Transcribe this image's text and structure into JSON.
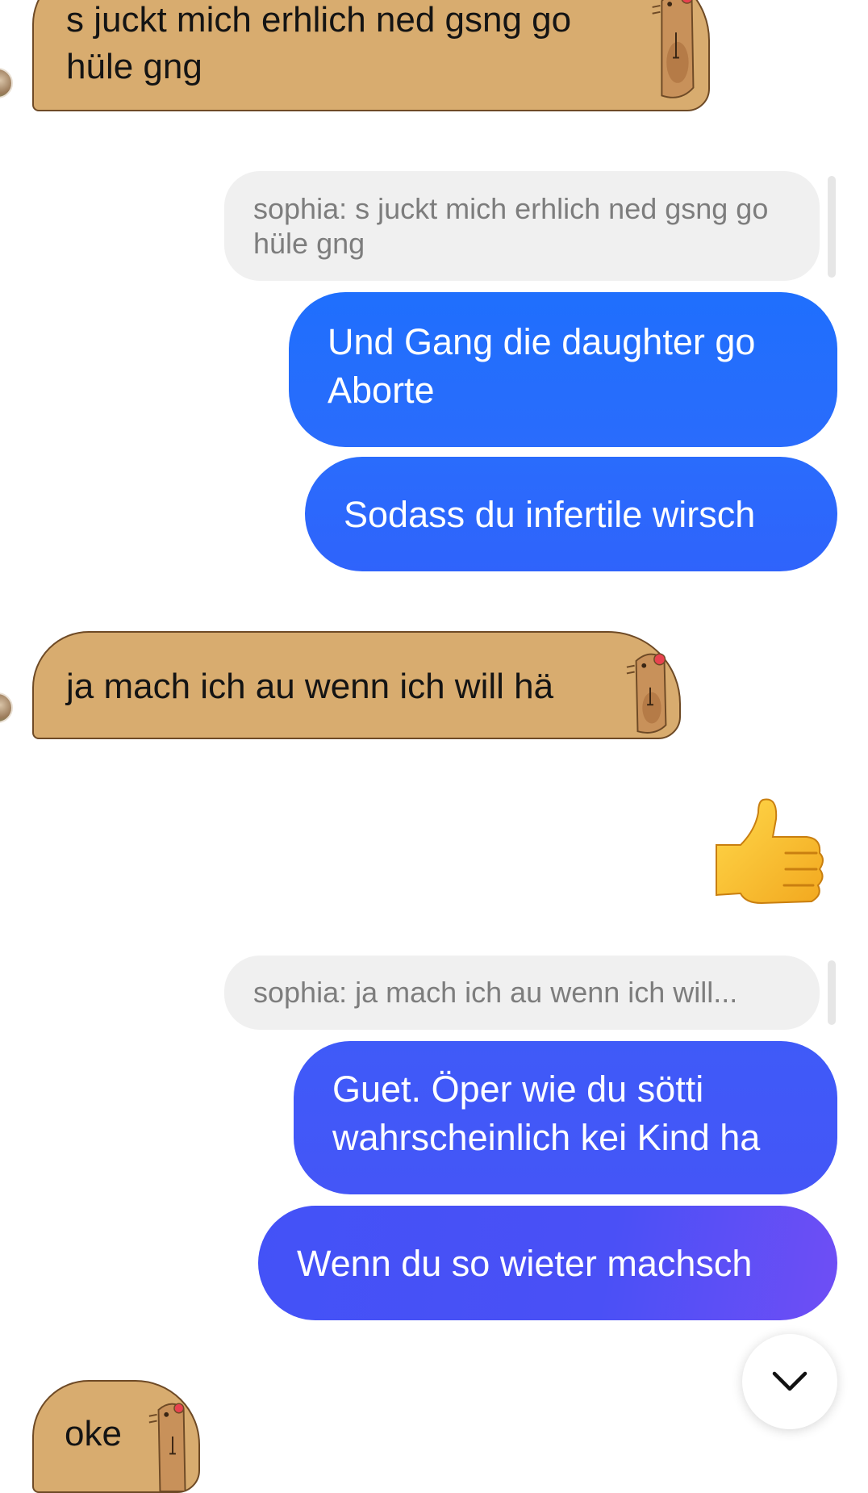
{
  "messages": [
    {
      "id": "m1",
      "direction": "incoming",
      "text": "s juckt mich erhlich ned gsng go hüle gng"
    },
    {
      "id": "m2",
      "direction": "outgoing",
      "reply_to": "sophia: s juckt mich erhlich ned gsng go hüle gng",
      "text": "Und Gang die daughter go Aborte"
    },
    {
      "id": "m3",
      "direction": "outgoing",
      "text": "Sodass du infertile wirsch"
    },
    {
      "id": "m4",
      "direction": "incoming",
      "text": "ja mach ich au wenn ich will hä"
    },
    {
      "id": "m5",
      "direction": "outgoing",
      "type": "emoji",
      "emoji": "thumbs-up"
    },
    {
      "id": "m6",
      "direction": "outgoing",
      "reply_to": "sophia: ja mach ich au wenn ich will...",
      "text": "Guet. Öper wie du sötti wahrscheinlich kei Kind ha"
    },
    {
      "id": "m7",
      "direction": "outgoing",
      "text": "Wenn du so wieter machsch"
    },
    {
      "id": "m8",
      "direction": "incoming",
      "text": "oke"
    }
  ],
  "scroll_button": {
    "icon": "chevron-down-icon"
  },
  "colors": {
    "incoming_bubble": "#d8ac6f",
    "incoming_border": "#6e4a26",
    "reply_preview_bg": "#f0f0f0",
    "reply_preview_text": "#7d7d7d",
    "outgoing_blue_top": "#1f6ffd",
    "outgoing_blue_mid": "#2a67fb",
    "outgoing_indigo": "#4057f7",
    "outgoing_violet": "#6e4ff5"
  }
}
